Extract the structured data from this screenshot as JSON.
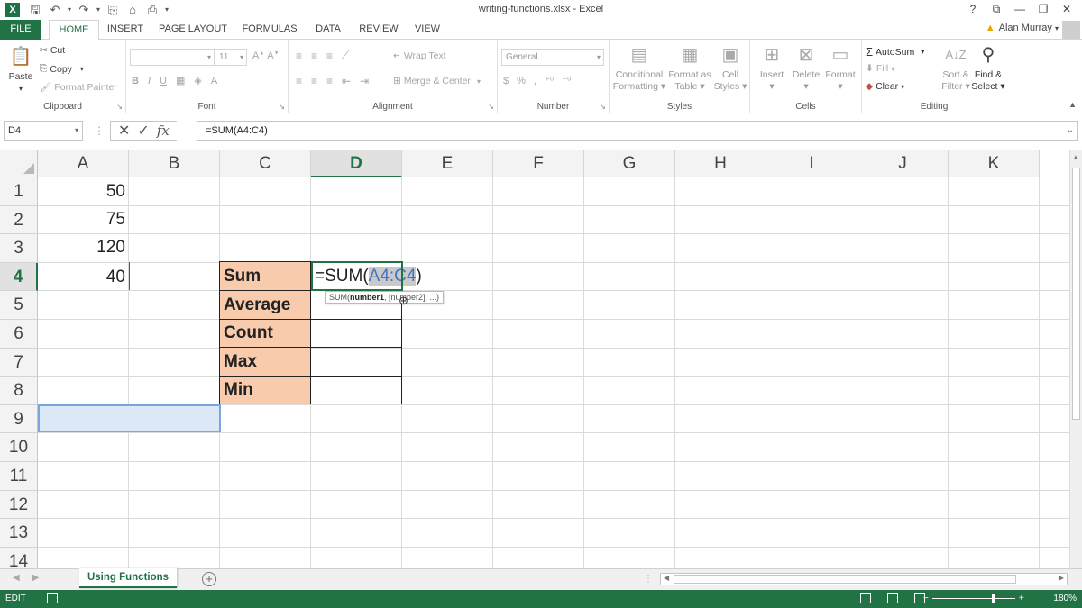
{
  "window": {
    "title": "writing-functions.xlsx - Excel",
    "help": "?",
    "restore": "⧉",
    "minimize": "—",
    "maximize": "❐",
    "close": "✕"
  },
  "tabs": {
    "file": "FILE",
    "home": "HOME",
    "insert": "INSERT",
    "page_layout": "PAGE LAYOUT",
    "formulas": "FORMULAS",
    "data": "DATA",
    "review": "REVIEW",
    "view": "VIEW"
  },
  "user": {
    "name": "Alan Murray"
  },
  "ribbon": {
    "clipboard": {
      "label": "Clipboard",
      "paste": "Paste",
      "cut": "Cut",
      "copy": "Copy",
      "format_painter": "Format Painter"
    },
    "font": {
      "label": "Font",
      "font_name": "",
      "font_size": "11",
      "bold": "B",
      "italic": "I",
      "underline": "U"
    },
    "alignment": {
      "label": "Alignment",
      "wrap_text": "Wrap Text",
      "merge_center": "Merge & Center"
    },
    "number": {
      "label": "Number",
      "format": "General",
      "currency": "$",
      "percent": "%",
      "comma": ","
    },
    "styles": {
      "label": "Styles",
      "conditional_1": "Conditional",
      "conditional_2": "Formatting",
      "format_table_1": "Format as",
      "format_table_2": "Table",
      "cell_styles_1": "Cell",
      "cell_styles_2": "Styles"
    },
    "cells": {
      "label": "Cells",
      "insert": "Insert",
      "delete": "Delete",
      "format": "Format"
    },
    "editing": {
      "label": "Editing",
      "autosum": "AutoSum",
      "fill": "Fill",
      "clear": "Clear",
      "sort_1": "Sort &",
      "sort_2": "Filter",
      "find_1": "Find &",
      "find_2": "Select"
    }
  },
  "formula_bar": {
    "name_box": "D4",
    "formula": "=SUM(A4:C4)",
    "fx": "fx"
  },
  "columns": [
    "A",
    "B",
    "C",
    "D",
    "E",
    "F",
    "G",
    "H",
    "I",
    "J",
    "K"
  ],
  "selected_column": "D",
  "rows": [
    "1",
    "2",
    "3",
    "4",
    "5",
    "6",
    "7",
    "8",
    "9",
    "10",
    "11",
    "12",
    "13",
    "14"
  ],
  "selected_row": "4",
  "cells": {
    "A1": "50",
    "A2": "75",
    "A3": "120",
    "A4": "40",
    "C4": "Sum",
    "C5": "Average",
    "C6": "Count",
    "C7": "Max",
    "C8": "Min"
  },
  "edit": {
    "prefix": "=SUM(",
    "ref": "A4:C4",
    "suffix": ")"
  },
  "tooltip": {
    "fn": "SUM(",
    "arg1": "number1",
    "rest": ", [number2], ...)"
  },
  "sheet": {
    "tab": "Using Functions",
    "add": "+"
  },
  "status": {
    "mode": "EDIT",
    "zoom": "180%"
  },
  "colors": {
    "accent": "#217346",
    "label_fill": "#f8cbad",
    "ref_blue": "#4472c4"
  }
}
